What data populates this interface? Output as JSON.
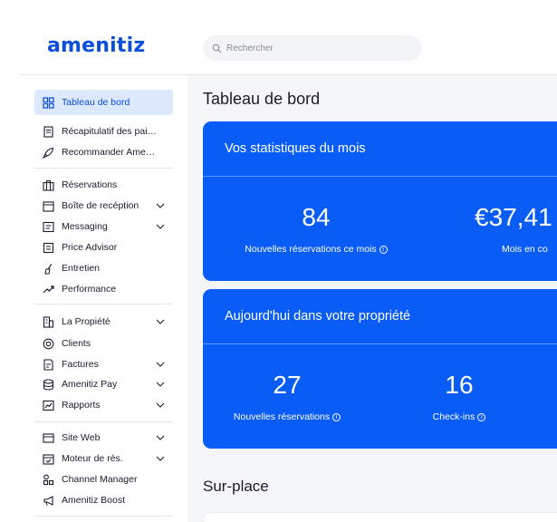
{
  "app": {
    "logo_text": "amenitiz",
    "brand_color": "#0a4ede",
    "accent_color": "#0a5cf7"
  },
  "search": {
    "placeholder": "Rechercher"
  },
  "sidebar": {
    "items": [
      {
        "label": "Tableau de bord",
        "icon": "grid-icon",
        "active": true
      },
      {
        "label": "Récapitulatif des pai…",
        "icon": "receipt-icon"
      },
      {
        "label": "Recommander Ame…",
        "icon": "rocket-icon"
      },
      {
        "label": "Réservations",
        "icon": "suitcase-icon"
      },
      {
        "label": "Boîte de recéption",
        "icon": "calendar-icon",
        "expandable": true
      },
      {
        "label": "Messaging",
        "icon": "message-icon",
        "expandable": true
      },
      {
        "label": "Price Advisor",
        "icon": "price-icon"
      },
      {
        "label": "Entretien",
        "icon": "broom-icon"
      },
      {
        "label": "Performance",
        "icon": "trend-icon"
      },
      {
        "label": "La Propiété",
        "icon": "building-icon",
        "expandable": true
      },
      {
        "label": "Clients",
        "icon": "at-icon"
      },
      {
        "label": "Factures",
        "icon": "invoice-icon",
        "expandable": true
      },
      {
        "label": "Amenitiz Pay",
        "icon": "database-icon",
        "expandable": true
      },
      {
        "label": "Rapports",
        "icon": "chart-icon",
        "expandable": true
      },
      {
        "label": "Site Web",
        "icon": "browser-icon",
        "expandable": true
      },
      {
        "label": "Moteur de rés.",
        "icon": "calendar-check-icon",
        "expandable": true
      },
      {
        "label": "Channel Manager",
        "icon": "channel-icon"
      },
      {
        "label": "Amenitiz Boost",
        "icon": "megaphone-icon"
      }
    ]
  },
  "main": {
    "title": "Tableau de bord",
    "monthly": {
      "title": "Vos statistiques du mois",
      "stats": [
        {
          "value": "84",
          "label": "Nouvelles réservations ce mois"
        },
        {
          "value": "€37,41",
          "label": "Mois en co"
        }
      ]
    },
    "today": {
      "title": "Aujourd'hui dans votre propriété",
      "stats": [
        {
          "value": "27",
          "label": "Nouvelles réservations"
        },
        {
          "value": "16",
          "label": "Check-ins"
        }
      ]
    },
    "onsite_title": "Sur-place"
  }
}
